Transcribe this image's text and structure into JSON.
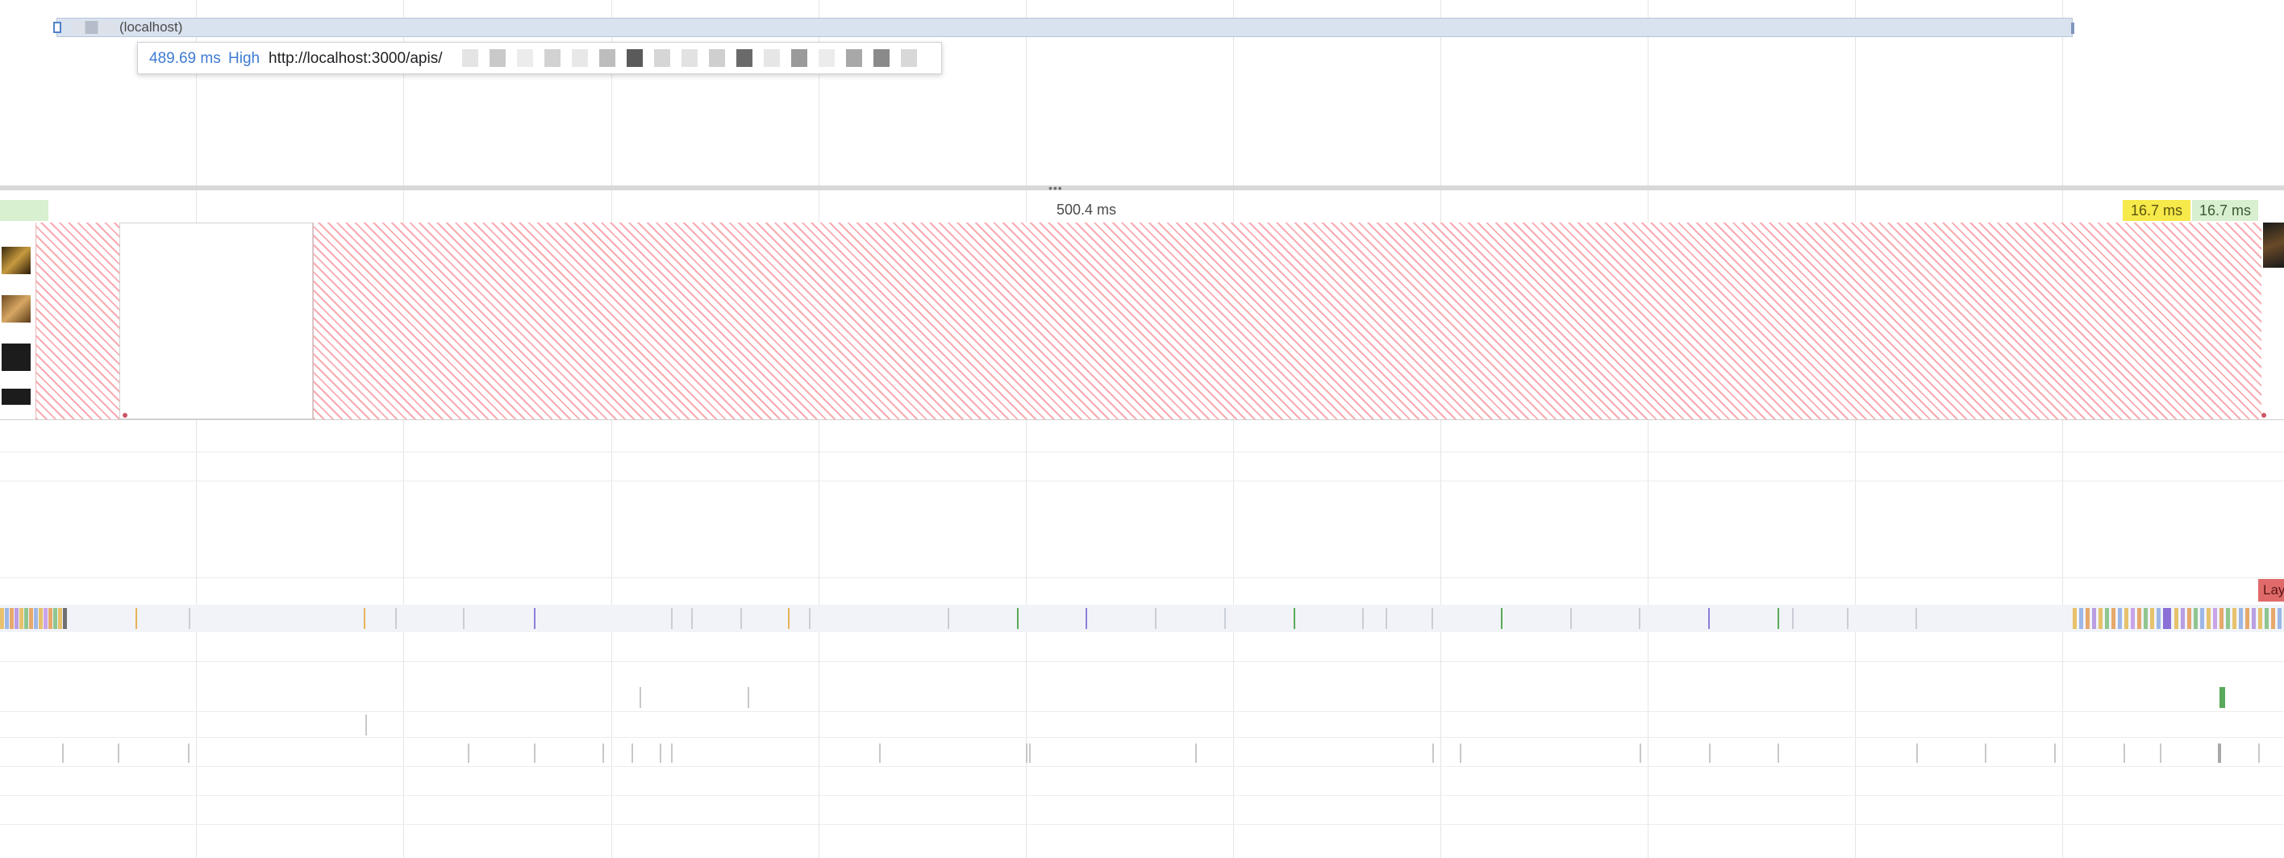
{
  "network_track": {
    "request_label": "(localhost)"
  },
  "tooltip": {
    "time": "489.69 ms",
    "priority": "High",
    "url": "http://localhost:3000/apis/"
  },
  "frames_track": {
    "frame_duration": "500.4 ms",
    "badge_yellow": "16.7 ms",
    "badge_green": "16.7 ms"
  },
  "layout_shift": {
    "label": "Lay"
  },
  "colors": {
    "request_bar": "#d9e2ef",
    "frame_dropped": "#f7aab0",
    "frame_ok": "#d8efd0",
    "frame_partial": "#f6e94a",
    "layout_shift": "#e06a6a",
    "link_blue": "#3e7bd1"
  }
}
